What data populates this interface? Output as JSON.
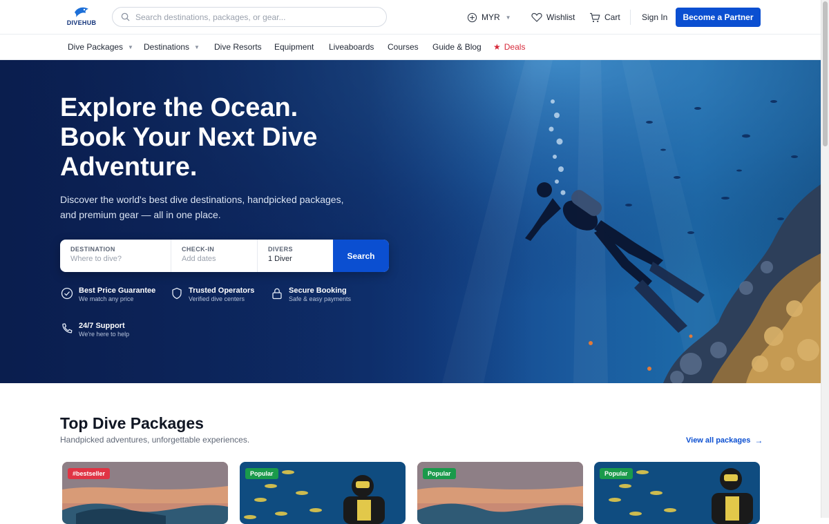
{
  "brand": {
    "name": "DIVEHUB",
    "accent": "#0b4fd1"
  },
  "header": {
    "search_placeholder": "Search destinations, packages, or gear...",
    "currency": "MYR",
    "wishlist": "Wishlist",
    "cart": "Cart",
    "signin": "Sign In",
    "partner": "Become a Partner"
  },
  "nav": {
    "items": [
      "Dive Packages",
      "Destinations",
      "Dive Resorts",
      "Equipment",
      "Liveaboards",
      "Courses",
      "Guide & Blog",
      "Deals"
    ]
  },
  "hero": {
    "title_line1": "Explore the Ocean.",
    "title_line2": "Book Your Next Dive",
    "title_line3": "Adventure.",
    "subtitle": "Discover the world's best dive destinations, handpicked packages, and premium gear — all in one place."
  },
  "booking": {
    "destination_label": "DESTINATION",
    "destination_placeholder": "Where to dive?",
    "checkin_label": "CHECK-IN",
    "checkin_placeholder": "Add dates",
    "divers_label": "DIVERS",
    "divers_value": "1 Diver",
    "search": "Search"
  },
  "features": [
    {
      "title": "Best Price Guarantee",
      "sub": "We match any price",
      "icon": "check-circle-icon"
    },
    {
      "title": "Trusted Operators",
      "sub": "Verified dive centers",
      "icon": "shield-icon"
    },
    {
      "title": "Secure Booking",
      "sub": "Safe & easy payments",
      "icon": "lock-icon"
    },
    {
      "title": "24/7 Support",
      "sub": "We're here to help",
      "icon": "phone-icon"
    }
  ],
  "packages": {
    "title": "Top Dive Packages",
    "subtitle": "Handpicked adventures, unforgettable experiences.",
    "view_all": "View all packages",
    "cards": [
      {
        "badge": "#bestseller"
      },
      {
        "badge": "Popular"
      },
      {
        "badge": "Popular"
      },
      {
        "badge": "Popular"
      }
    ]
  }
}
